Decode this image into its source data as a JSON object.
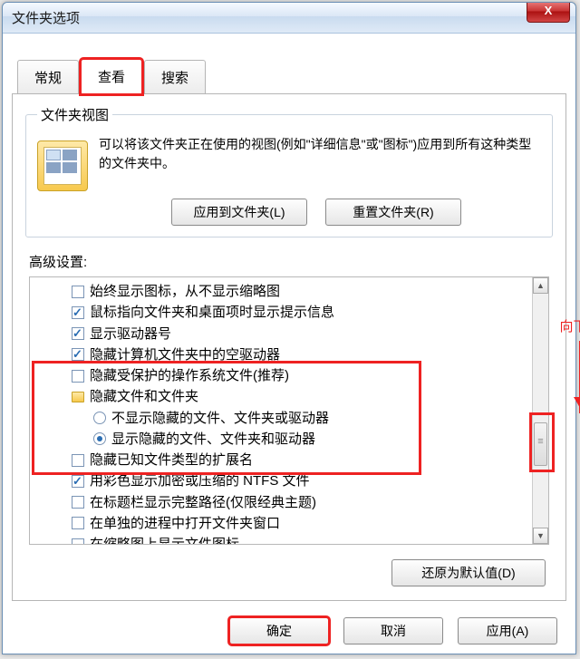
{
  "window": {
    "title": "文件夹选项",
    "close_x": "X"
  },
  "tabs": {
    "general": "常规",
    "view": "查看",
    "search": "搜索"
  },
  "folder_view": {
    "legend": "文件夹视图",
    "desc": "可以将该文件夹正在使用的视图(例如\"详细信息\"或\"图标\")应用到所有这种类型的文件夹中。",
    "apply_btn": "应用到文件夹(L)",
    "reset_btn": "重置文件夹(R)"
  },
  "advanced": {
    "label": "高级设置:",
    "items": [
      {
        "kind": "cb",
        "checked": false,
        "text": "始终显示图标，从不显示缩略图"
      },
      {
        "kind": "cb",
        "checked": true,
        "text": "鼠标指向文件夹和桌面项时显示提示信息"
      },
      {
        "kind": "cb",
        "checked": true,
        "text": "显示驱动器号"
      },
      {
        "kind": "cb",
        "checked": true,
        "text": "隐藏计算机文件夹中的空驱动器"
      },
      {
        "kind": "cb",
        "checked": false,
        "text": "隐藏受保护的操作系统文件(推荐)"
      },
      {
        "kind": "folder",
        "text": "隐藏文件和文件夹"
      },
      {
        "kind": "rb",
        "checked": false,
        "text": "不显示隐藏的文件、文件夹或驱动器"
      },
      {
        "kind": "rb",
        "checked": true,
        "text": "显示隐藏的文件、文件夹和驱动器"
      },
      {
        "kind": "cb",
        "checked": false,
        "text": "隐藏已知文件类型的扩展名"
      },
      {
        "kind": "cb",
        "checked": true,
        "text": "用彩色显示加密或压缩的 NTFS 文件"
      },
      {
        "kind": "cb",
        "checked": false,
        "text": "在标题栏显示完整路径(仅限经典主题)"
      },
      {
        "kind": "cb",
        "checked": false,
        "text": "在单独的进程中打开文件夹窗口"
      },
      {
        "kind": "cb",
        "checked": false,
        "text": "在缩略图上显示文件图标"
      }
    ],
    "restore_btn": "还原为默认值(D)"
  },
  "annotation": {
    "scroll_hint": "向下拉"
  },
  "footer": {
    "ok": "确定",
    "cancel": "取消",
    "apply": "应用(A)"
  }
}
